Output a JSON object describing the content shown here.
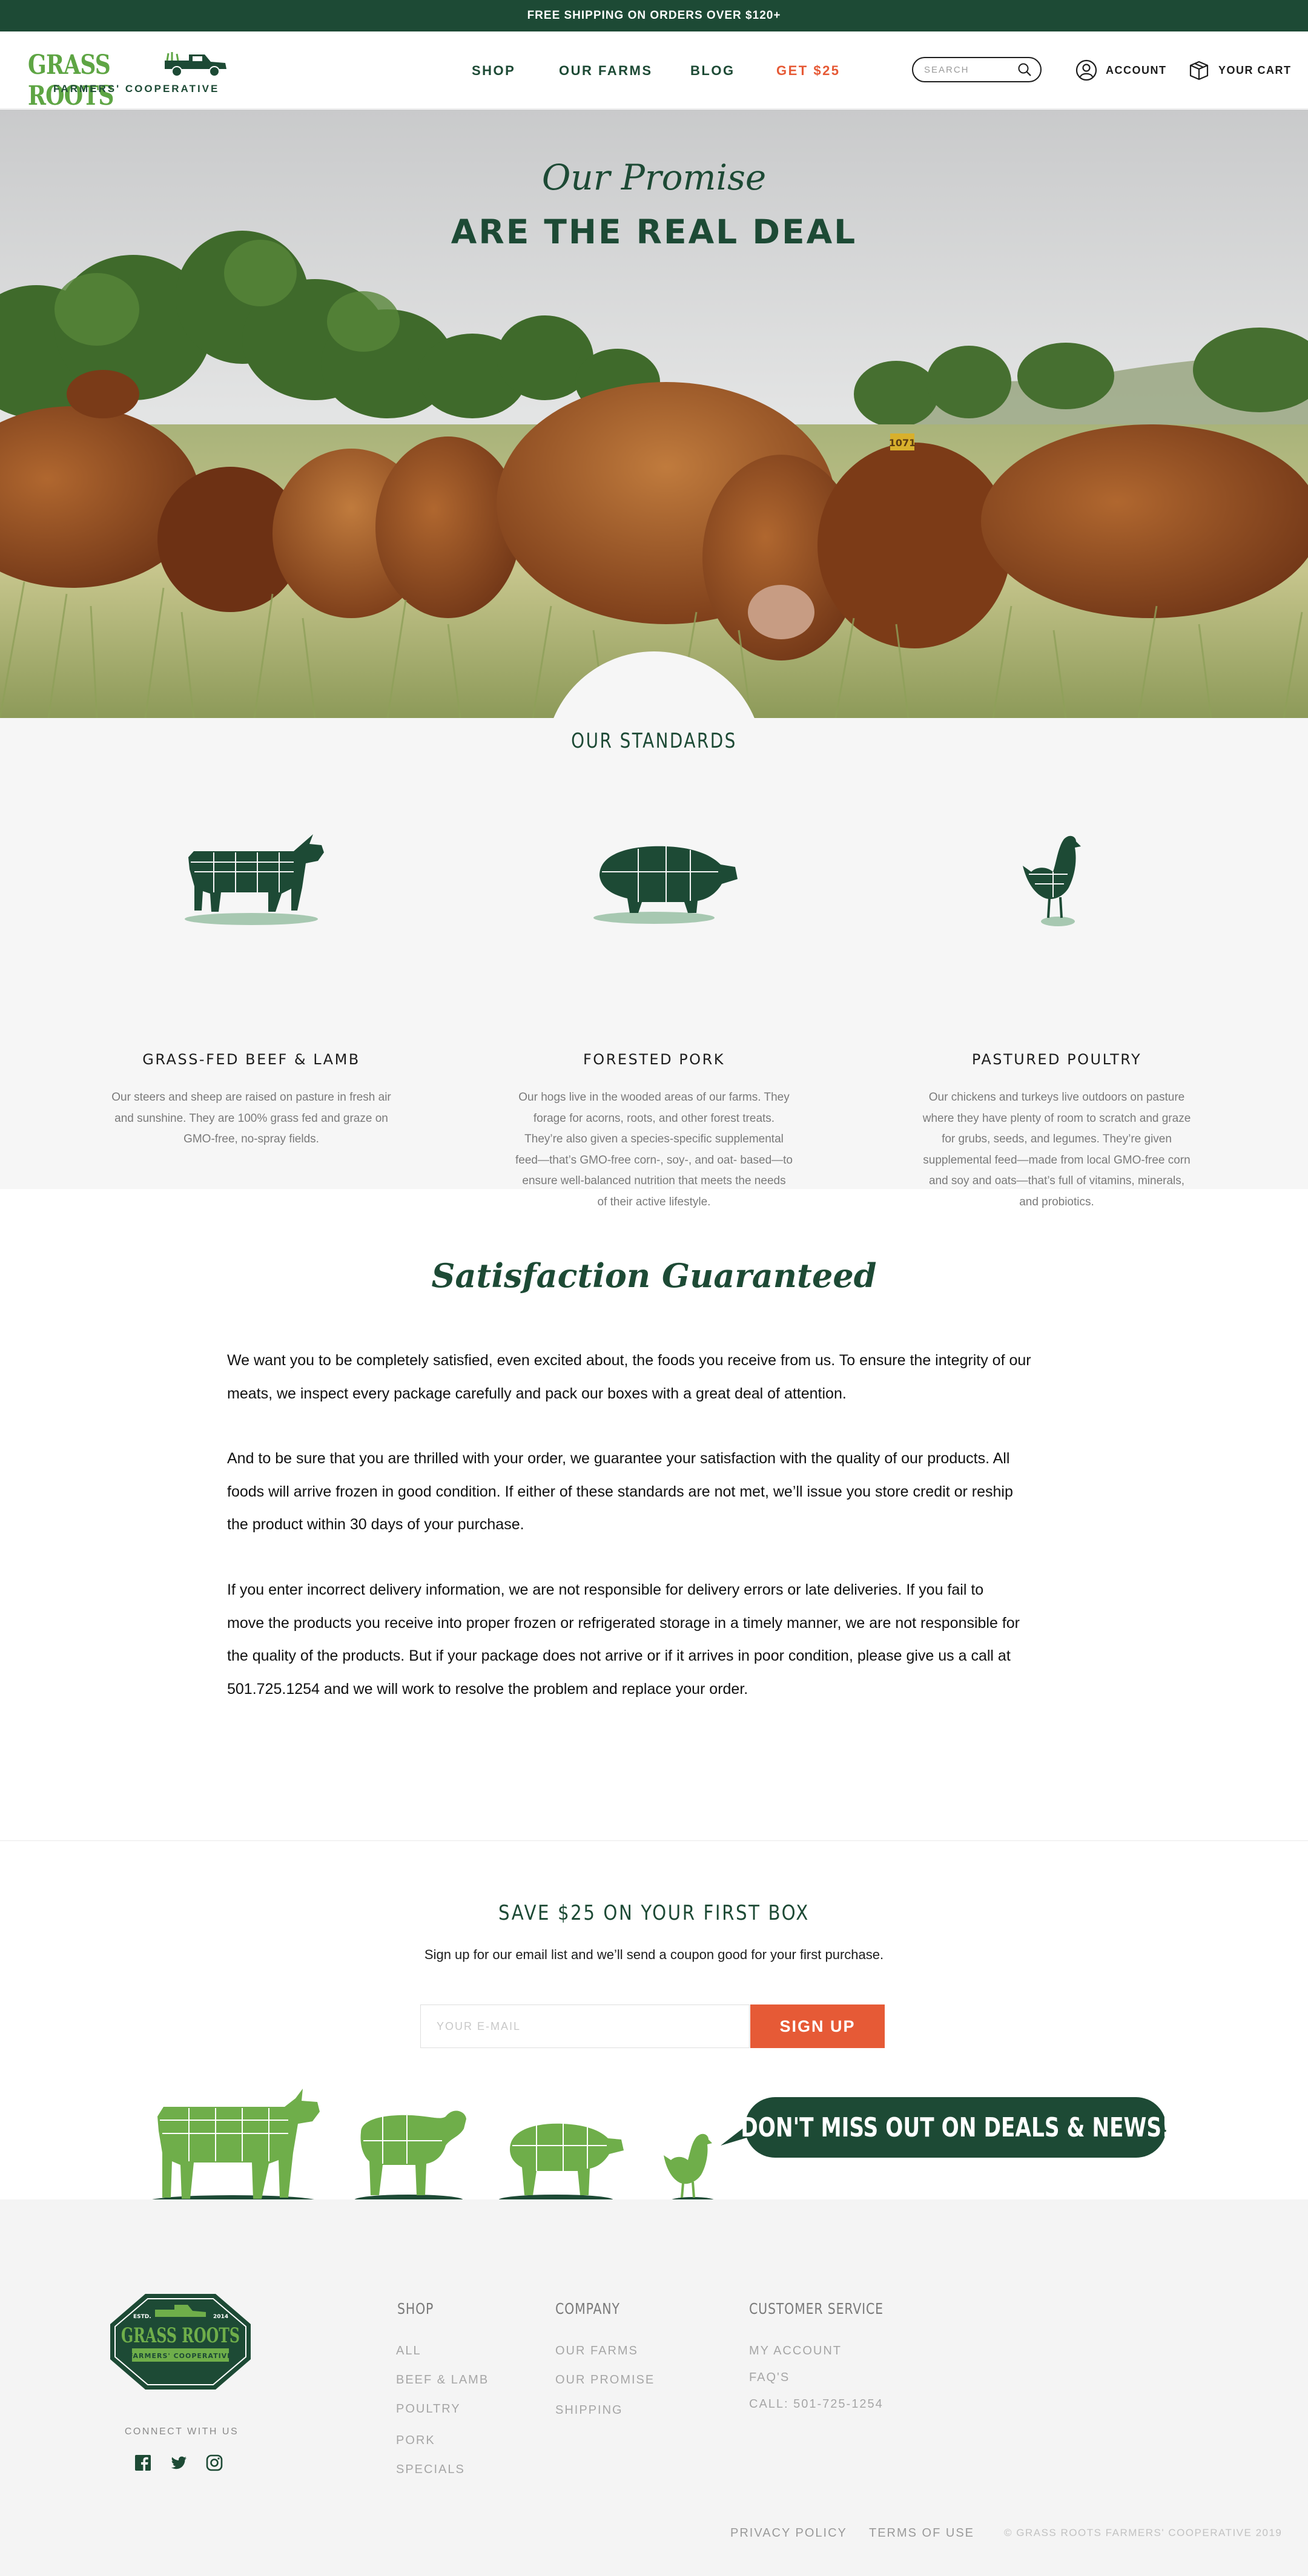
{
  "topbar": {
    "text": "FREE SHIPPING ON ORDERS OVER $120+"
  },
  "brand": {
    "name": "GRASS ROOTS",
    "tagline": "FARMERS' COOPERATIVE",
    "estd_left": "ESTD.",
    "estd_right": "2014"
  },
  "nav": {
    "items": [
      "SHOP",
      "OUR FARMS",
      "BLOG",
      "GET $25"
    ]
  },
  "search": {
    "placeholder": "SEARCH"
  },
  "header_links": {
    "account": "ACCOUNT",
    "cart": "YOUR CART"
  },
  "hero": {
    "script": "Our Promise",
    "title": "ARE THE REAL DEAL",
    "ear_tag": "1071"
  },
  "standards": {
    "heading": "OUR STANDARDS",
    "items": [
      {
        "icon": "cow-icon",
        "title": "GRASS-FED BEEF & LAMB",
        "lines": [
          "Our steers and sheep are raised on pasture in fresh air",
          "and sunshine. They are 100% grass fed and graze on",
          "GMO-free, no-spray fields."
        ]
      },
      {
        "icon": "pig-icon",
        "title": "FORESTED PORK",
        "lines": [
          "Our hogs live in the wooded areas of our farms. They",
          "forage for acorns, roots, and other forest treats.",
          "They’re also given a species-specific supplemental",
          "feed—that’s GMO-free corn-, soy-, and oat- based—to",
          "ensure well-balanced nutrition that meets the needs",
          "of their active lifestyle."
        ]
      },
      {
        "icon": "chicken-icon",
        "title": "PASTURED POULTRY",
        "lines": [
          "Our chickens and turkeys live outdoors on pasture",
          "where they have plenty of room to scratch and graze",
          "for grubs, seeds, and legumes. They’re given",
          "supplemental feed—made from local GMO-free corn",
          "and soy and oats—that’s full of vitamins, minerals,",
          "and probiotics."
        ]
      }
    ]
  },
  "satisfaction": {
    "heading": "Satisfaction Guaranteed",
    "paragraphs": [
      [
        "We want you to be completely satisfied, even excited about, the foods you receive from us. To ensure the integrity of our",
        "meats, we inspect every package carefully and pack our boxes with a great deal of attention."
      ],
      [
        "And to be sure that you are thrilled with your order, we guarantee your satisfaction with the quality of our products. All",
        "foods will arrive frozen in good condition. If either of these standards are not met, we’ll issue you store credit or reship",
        "the product within 30 days of your purchase."
      ],
      [
        "If you enter incorrect delivery information, we are not responsible for delivery errors or late deliveries. If you fail to",
        "move the products you receive into proper frozen or refrigerated storage in a timely manner, we are not responsible for",
        "the quality of the products. But if your package does not arrive or if it arrives in poor condition, please give us a call at",
        "501.725.1254 and we will work to resolve the problem and replace your order."
      ]
    ]
  },
  "signup": {
    "heading": "SAVE $25 ON YOUR FIRST BOX",
    "subtext": "Sign up for our email list and we’ll send a coupon good for your first purchase.",
    "email_placeholder": "YOUR E-MAIL",
    "button": "SIGN UP",
    "bubble": "DON'T MISS OUT ON DEALS & NEWS!"
  },
  "footer": {
    "connect": "CONNECT WITH US",
    "social": [
      "facebook-icon",
      "twitter-icon",
      "instagram-icon"
    ],
    "columns": [
      {
        "title": "SHOP",
        "links": [
          "ALL",
          "BEEF & LAMB",
          "POULTRY",
          "PORK",
          "SPECIALS"
        ]
      },
      {
        "title": "COMPANY",
        "links": [
          "OUR FARMS",
          "OUR PROMISE",
          "SHIPPING"
        ]
      },
      {
        "title": "CUSTOMER SERVICE",
        "links": [
          "MY ACCOUNT",
          "FAQ'S",
          "CALL: 501-725-1254"
        ]
      }
    ],
    "privacy": "PRIVACY POLICY",
    "terms": "TERMS OF USE",
    "copyright": "© GRASS ROOTS FARMERS' COOPERATIVE 2019"
  },
  "colors": {
    "brand_green": "#1d4a35",
    "light_green": "#5ea544",
    "accent_orange": "#e65a36"
  }
}
